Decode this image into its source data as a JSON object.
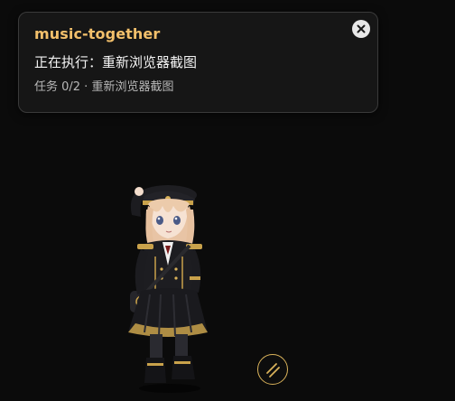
{
  "notification": {
    "title": "music-together",
    "status": "正在执行：重新浏览器截图",
    "task": "任务 0/2 · 重新浏览器截图",
    "close_icon": "close-icon"
  },
  "character": {
    "description_icon": "anime-girl-illustration"
  },
  "action_button": {
    "icon": "stripes-icon",
    "accent_color": "#d9b25a"
  },
  "colors": {
    "title": "#f3c06b",
    "background": "#0b0b0b",
    "card": "#161616"
  }
}
